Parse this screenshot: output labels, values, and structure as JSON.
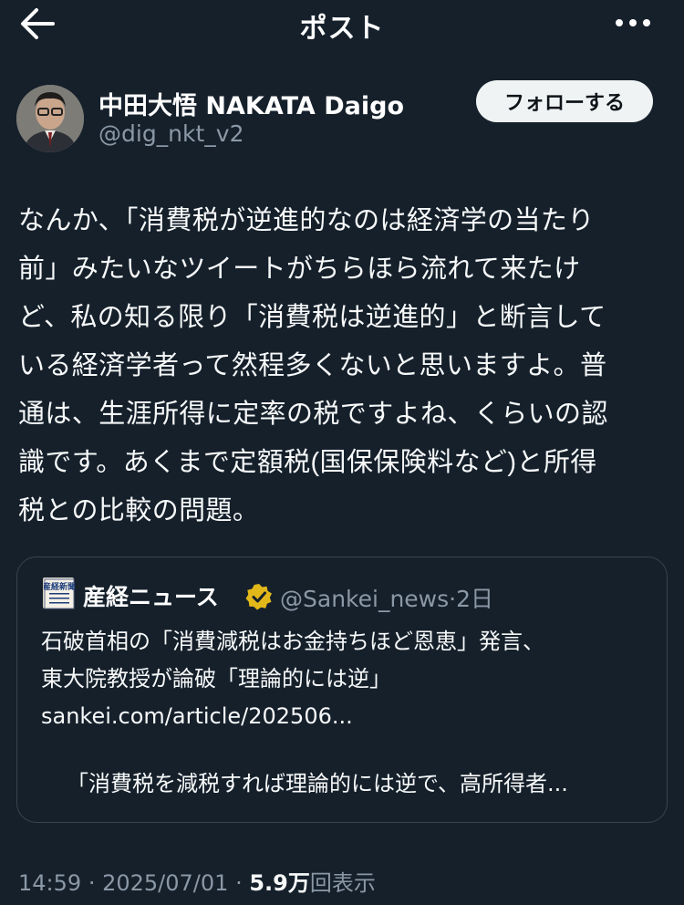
{
  "header": {
    "title": "ポスト",
    "back_icon": "arrow-left-icon",
    "more_icon": "more-horizontal-icon"
  },
  "author": {
    "display_name": "中田大悟 NAKATA Daigo",
    "handle": "@dig_nkt_v2",
    "follow_label": "フォローする"
  },
  "post": {
    "lines": [
      "なんか、「消費税が逆進的なのは経済学の当たり",
      "前」みたいなツイートがちらほら流れて来たけ",
      "ど、私の知る限り「消費税は逆進的」と断言して",
      "いる経済学者って然程多くないと思いますよ。普",
      "通は、生涯所得に定率の税ですよね、くらいの認",
      "識です。あくまで定額税(国保保険料など)と所得",
      "税との比較の問題。"
    ]
  },
  "quote": {
    "avatar_icon": "sankei-logo",
    "avatar_text": "産経新聞",
    "name": "産経ニュース",
    "verified_icon": "verified-badge-gold",
    "handle": "@Sankei_news",
    "separator": "·",
    "time": "2日",
    "text_line1": "石破首相の「消費減税はお金持ちほど恩恵」発言、",
    "text_line2": "東大院教授が論破「理論的には逆」",
    "link": "sankei.com/article/202506...",
    "excerpt": "「消費税を減税すれば理論的には逆で、高所得者..."
  },
  "meta": {
    "time": "14:59",
    "sep1": "·",
    "date": "2025/07/01",
    "sep2": "·",
    "views_count": "5.9万",
    "views_label": "回表示"
  },
  "colors": {
    "background": "#15202b",
    "secondary_text": "#8b98a5",
    "border": "#38444d",
    "verified_gold": "#e2b719"
  }
}
